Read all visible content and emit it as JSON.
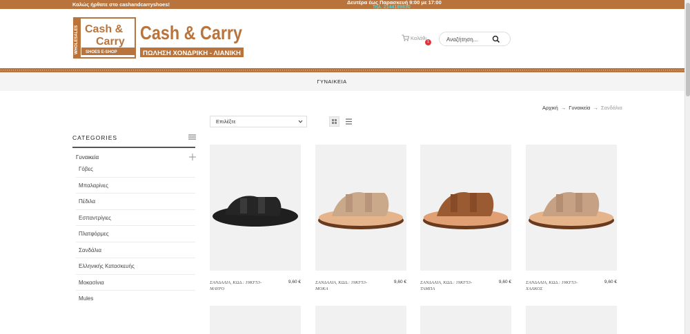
{
  "topbar": {
    "welcome": "Καλώς ήρθατε στο cashandcarryshoes!",
    "hours": "Δευτέρα έως Παρασκευή 9:00 με 17:00",
    "phone": "Τηλ. 2144189830"
  },
  "logo": {
    "badge_line1": "Cash &",
    "badge_line2": "Carry",
    "badge_side": "WHOLESALES",
    "badge_bottom": "SHOES   E-SHOP",
    "main_text": "Cash & Carry",
    "sub_text": "ΠΩΛΗΣΗ ΧΟΝΔΡΙΚΗ - ΛΙΑΝΙΚΗ"
  },
  "header": {
    "cart_label": "Καλάθι",
    "cart_count": "1",
    "search_placeholder": "Αναζήτηση..."
  },
  "nav": {
    "items": [
      {
        "label": "ΓΥΝΑΙΚΕΙΑ"
      }
    ]
  },
  "breadcrumb": {
    "home": "Αρχική",
    "parent": "Γυναικεία",
    "current": "Σανδάλια"
  },
  "sidebar": {
    "title": "CATEGORIES",
    "parent": "Γυναικεία",
    "items": [
      {
        "label": "Γόβες"
      },
      {
        "label": "Μπαλαρίνες"
      },
      {
        "label": "Πέδιλα"
      },
      {
        "label": "Εσπαντρίγιες"
      },
      {
        "label": "Πλατφόρμες"
      },
      {
        "label": "Σανδάλια"
      },
      {
        "label": "Ελληνικής Κατασκευής"
      },
      {
        "label": "Μοκασίνια"
      },
      {
        "label": "Mules"
      }
    ]
  },
  "toolbar": {
    "sort_selected": "Επιλέξτε"
  },
  "products": [
    {
      "name": "ΣΑΝΔΑΛΙΑ, ΚΩΔ.: 19KF53-ΜΑΥΡΟ",
      "price": "9,60 €",
      "color": "#1f1f1f"
    },
    {
      "name": "ΣΑΝΔΑΛΙΑ, ΚΩΔ.: 19KF53-ΜΟΚΑ",
      "price": "9,60 €",
      "color": "#c9a98a"
    },
    {
      "name": "ΣΑΝΔΑΛΙΑ, ΚΩΔ.: 19KF53-ΤΑΜΠΑ",
      "price": "9,60 €",
      "color": "#9a5a32"
    },
    {
      "name": "ΣΑΝΔΑΛΙΑ, ΚΩΔ.: 19KF53-ΧΑΛΚΟΣ",
      "price": "9,60 €",
      "color": "#c7a183"
    }
  ],
  "colors": {
    "brand_brown": "#b8743c",
    "phone_cyan": "#5fd0d8",
    "badge_red": "#e0363b"
  }
}
